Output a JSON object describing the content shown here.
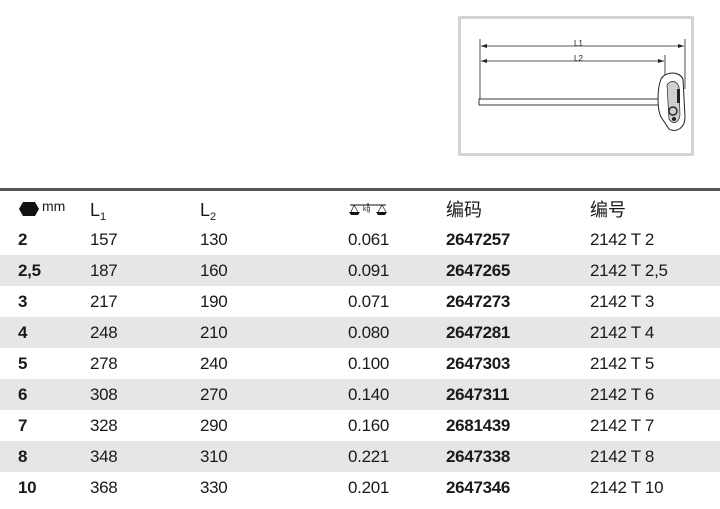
{
  "diagram": {
    "l1_label": "L1",
    "l2_label": "L2"
  },
  "table": {
    "headers": {
      "size_unit": "mm",
      "l1": "L",
      "l1_sub": "1",
      "l2": "L",
      "l2_sub": "2",
      "weight_icon_text": "kg",
      "code": "编码",
      "number": "编号"
    },
    "rows": [
      {
        "size": "2",
        "l1": "157",
        "l2": "130",
        "weight": "0.061",
        "code": "2647257",
        "number": "2142 T 2"
      },
      {
        "size": "2,5",
        "l1": "187",
        "l2": "160",
        "weight": "0.091",
        "code": "2647265",
        "number": "2142 T 2,5"
      },
      {
        "size": "3",
        "l1": "217",
        "l2": "190",
        "weight": "0.071",
        "code": "2647273",
        "number": "2142 T 3"
      },
      {
        "size": "4",
        "l1": "248",
        "l2": "210",
        "weight": "0.080",
        "code": "2647281",
        "number": "2142 T 4"
      },
      {
        "size": "5",
        "l1": "278",
        "l2": "240",
        "weight": "0.100",
        "code": "2647303",
        "number": "2142 T 5"
      },
      {
        "size": "6",
        "l1": "308",
        "l2": "270",
        "weight": "0.140",
        "code": "2647311",
        "number": "2142 T 6"
      },
      {
        "size": "7",
        "l1": "328",
        "l2": "290",
        "weight": "0.160",
        "code": "2681439",
        "number": "2142 T 7"
      },
      {
        "size": "8",
        "l1": "348",
        "l2": "310",
        "weight": "0.221",
        "code": "2647338",
        "number": "2142 T 8"
      },
      {
        "size": "10",
        "l1": "368",
        "l2": "330",
        "weight": "0.201",
        "code": "2647346",
        "number": "2142 T 10"
      }
    ]
  },
  "icons": {
    "hex_size": "hexagon-icon",
    "weight": "scale-icon"
  },
  "colors": {
    "row_shade": "#e6e6e6",
    "rule": "#555555",
    "frame": "#d4d4d4"
  }
}
